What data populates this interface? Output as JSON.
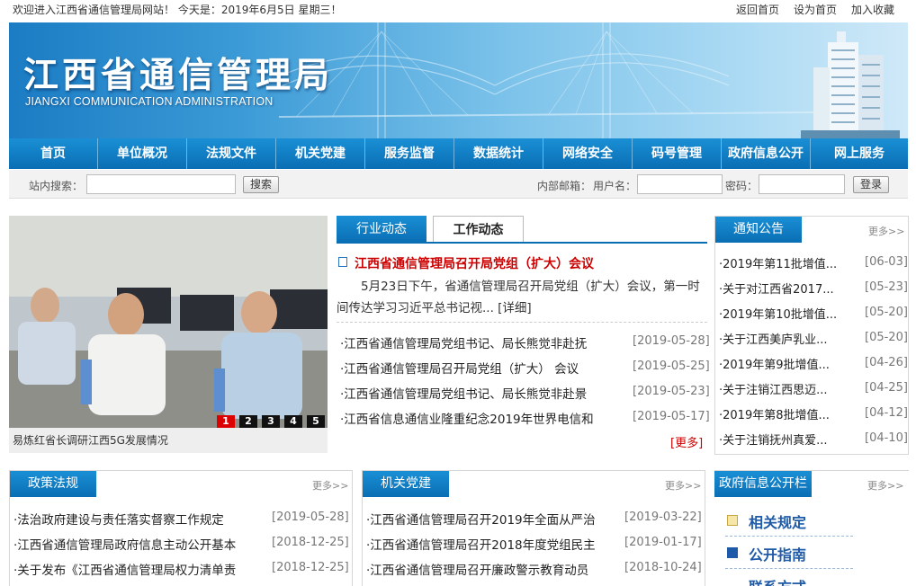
{
  "top": {
    "welcome": "欢迎进入江西省通信管理局网站！ 今天是：2019年6月5日 星期三！",
    "links": [
      "返回首页",
      "设为首页",
      "加入收藏"
    ]
  },
  "banner": {
    "title": "江西省通信管理局",
    "subtitle": "JIANGXI COMMUNICATION ADMINISTRATION"
  },
  "nav": [
    "首页",
    "单位概况",
    "法规文件",
    "机关党建",
    "服务监督",
    "数据统计",
    "网络安全",
    "码号管理",
    "政府信息公开",
    "网上服务"
  ],
  "search": {
    "label": "站内搜索：",
    "button": "搜索",
    "mail_label": "内部邮箱：",
    "user_label": "用户名：",
    "pass_label": "密码：",
    "login": "登录"
  },
  "photo": {
    "caption": "易炼红省长调研江西5G发展情况",
    "slides": [
      "1",
      "2",
      "3",
      "4",
      "5"
    ]
  },
  "news": {
    "tabs": [
      "行业动态",
      "工作动态"
    ],
    "headline": "江西省通信管理局召开局党组（扩大）会议",
    "summary": "5月23日下午，省通信管理局召开局党组（扩大）会议，第一时间传达学习习近平总书记视... [详细]",
    "items": [
      {
        "title": "·江西省通信管理局党组书记、局长熊觉非赴抚",
        "date": "[2019-05-28]"
      },
      {
        "title": "·江西省通信管理局召开局党组（扩大） 会议",
        "date": "[2019-05-25]"
      },
      {
        "title": "·江西省通信管理局党组书记、局长熊觉非赴景",
        "date": "[2019-05-23]"
      },
      {
        "title": "·江西省信息通信业隆重纪念2019年世界电信和",
        "date": "[2019-05-17]"
      }
    ],
    "more": "[更多]"
  },
  "notice": {
    "title": "通知公告",
    "more": "更多>>",
    "items": [
      {
        "title": "·2019年第11批增值...",
        "date": "[06-03]"
      },
      {
        "title": "·关于对江西省2017...",
        "date": "[05-23]"
      },
      {
        "title": "·2019年第10批增值...",
        "date": "[05-20]"
      },
      {
        "title": "·关于江西美庐乳业...",
        "date": "[05-20]"
      },
      {
        "title": "·2019年第9批增值...",
        "date": "[04-26]"
      },
      {
        "title": "·关于注销江西思迈...",
        "date": "[04-25]"
      },
      {
        "title": "·2019年第8批增值...",
        "date": "[04-12]"
      },
      {
        "title": "·关于注销抚州真爱...",
        "date": "[04-10]"
      }
    ]
  },
  "policy": {
    "title": "政策法规",
    "more": "更多>>",
    "items": [
      {
        "title": "·法治政府建设与责任落实督察工作规定",
        "date": "[2019-05-28]"
      },
      {
        "title": "·江西省通信管理局政府信息主动公开基本",
        "date": "[2018-12-25]"
      },
      {
        "title": "·关于发布《江西省通信管理局权力清单责",
        "date": "[2018-12-25]"
      }
    ]
  },
  "party": {
    "title": "机关党建",
    "more": "更多>>",
    "items": [
      {
        "title": "·江西省通信管理局召开2019年全面从严治",
        "date": "[2019-03-22]"
      },
      {
        "title": "·江西省通信管理局召开2018年度党组民主",
        "date": "[2019-01-17]"
      },
      {
        "title": "·江西省通信管理局召开廉政警示教育动员",
        "date": "[2018-10-24]"
      }
    ]
  },
  "gov": {
    "title": "政府信息公开栏",
    "more": "更多>>",
    "items": [
      "相关规定",
      "公开指南",
      "联系方式"
    ]
  },
  "colors": {
    "nav": "#0a6eb4",
    "accent_red": "#cc0000",
    "link_blue": "#1e5aa8"
  }
}
